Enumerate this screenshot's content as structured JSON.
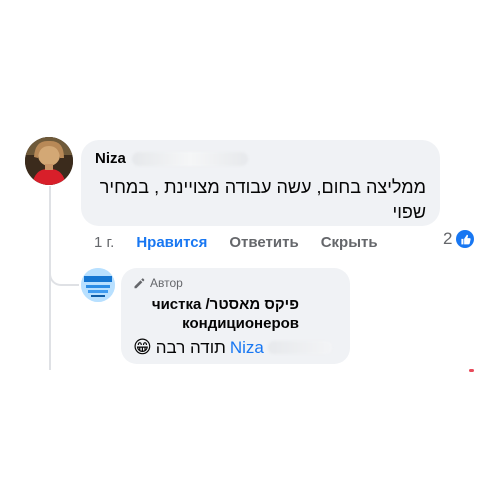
{
  "comment": {
    "author": "Niza",
    "text": "ממליצה בחום, עשה עבודה מצויינת , במחיר שפוי",
    "time": "1 г.",
    "like_label": "Нравится",
    "reply_label": "Ответить",
    "hide_label": "Скрыть",
    "reaction_count": "2",
    "reaction_icon": "thumbs-up-icon",
    "accent_color": "#1877f2"
  },
  "reply": {
    "author_tag": "Автор",
    "author_name": "פיקס מאסטר/ чистка кондиционеров",
    "mention": "Niza",
    "text": "תודה רבה",
    "emoji": "😁"
  }
}
